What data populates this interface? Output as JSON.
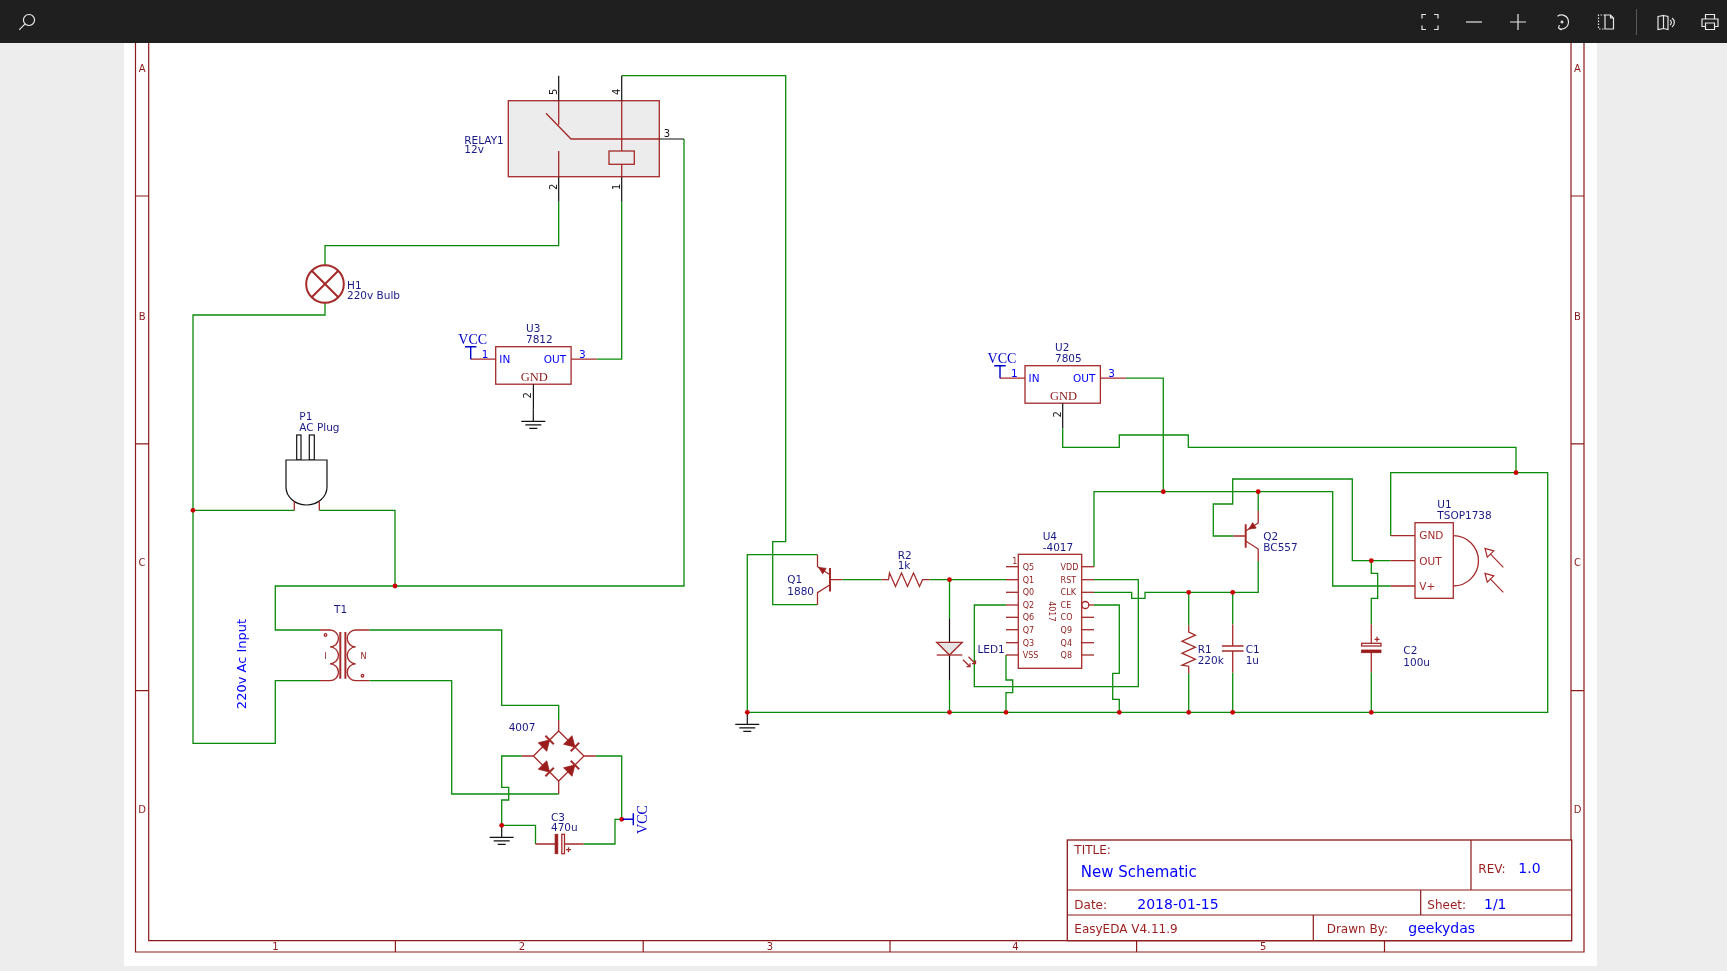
{
  "sheet": {
    "row_labels_left": [
      "A",
      "B",
      "C",
      "D"
    ],
    "row_labels_right": [
      "A",
      "B",
      "C",
      "D"
    ],
    "column_labels": [
      "1",
      "2",
      "3",
      "4",
      "5"
    ],
    "components": [
      {
        "kind": "relay",
        "designator": "RELAY1",
        "value": "12v",
        "pins": [
          "5",
          "4",
          "3",
          "2",
          "1"
        ]
      },
      {
        "kind": "lamp",
        "designator": "H1",
        "value": "220v Bulb"
      },
      {
        "kind": "regulator",
        "designator": "U3",
        "value": "7812",
        "supply": "VCC",
        "pins": [
          "1",
          "3",
          "2"
        ],
        "pin_names": [
          "IN",
          "OUT",
          "GND"
        ]
      },
      {
        "kind": "plug",
        "designator": "P1",
        "value": "AC Plug"
      },
      {
        "kind": "transformer",
        "designator": "T1",
        "pin_names": [
          "I",
          "N"
        ]
      },
      {
        "kind": "bridge",
        "value": "4007"
      },
      {
        "kind": "polarized_capacitor",
        "designator": "C3",
        "value": "470u"
      },
      {
        "kind": "npn",
        "designator": "Q1",
        "value": "1880"
      },
      {
        "kind": "resistor",
        "designator": "R2",
        "value": "1k"
      },
      {
        "kind": "led",
        "designator": "LED1"
      },
      {
        "kind": "ic",
        "designator": "U4",
        "value": "-4017",
        "body_text": "4017",
        "pin_1": "1",
        "pins_left": [
          "Q5",
          "Q1",
          "Q0",
          "Q2",
          "Q6",
          "Q7",
          "Q3",
          "VSS"
        ],
        "pins_right": [
          {
            "name": "VDD",
            "inverted": false
          },
          {
            "name": "RST",
            "inverted": false
          },
          {
            "name": "CLK",
            "inverted": false
          },
          {
            "name": "CE",
            "inverted": true
          },
          {
            "name": "CO",
            "inverted": false
          },
          {
            "name": "Q9",
            "inverted": false
          },
          {
            "name": "Q4",
            "inverted": false
          },
          {
            "name": "Q8",
            "inverted": false
          }
        ]
      },
      {
        "kind": "regulator",
        "designator": "U2",
        "value": "7805",
        "supply": "VCC",
        "pins": [
          "1",
          "3",
          "2"
        ],
        "pin_names": [
          "IN",
          "OUT",
          "GND"
        ]
      },
      {
        "kind": "pnp",
        "designator": "Q2",
        "value": "BC557"
      },
      {
        "kind": "ir_receiver",
        "designator": "U1",
        "value": "TSOP1738",
        "pin_names": [
          "GND",
          "OUT",
          "V+"
        ]
      },
      {
        "kind": "resistor",
        "designator": "R1",
        "value": "220k"
      },
      {
        "kind": "capacitor",
        "designator": "C1",
        "value": "1u"
      },
      {
        "kind": "polarized_capacitor",
        "designator": "C2",
        "value": "100u"
      }
    ],
    "power_label": "VCC",
    "note": "220v Ac Input",
    "title_block": {
      "title_label": "TITLE:",
      "title": "New Schematic",
      "rev_label": "REV:",
      "rev": "1.0",
      "date_label": "Date:",
      "date": "2018-01-15",
      "sheet_label": "Sheet:",
      "sheet": "1/1",
      "software": "EasyEDA V4.11.9",
      "drawn_by_label": "Drawn By:",
      "drawn_by": "geekydas"
    }
  }
}
